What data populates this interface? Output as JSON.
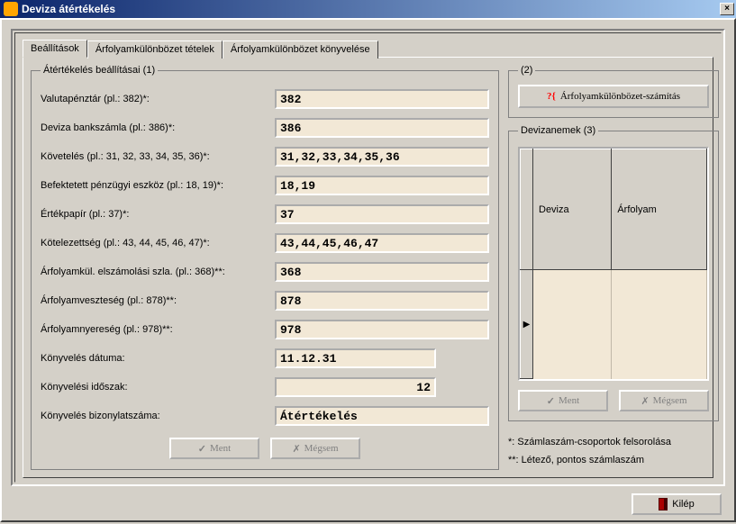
{
  "window": {
    "title": "Deviza átértékelés"
  },
  "tabs": {
    "t1": "Beállítások",
    "t2": "Árfolyamkülönbözet tételek",
    "t3": "Árfolyamkülönbözet könyvelése"
  },
  "groupbox": {
    "left": "Átértékelés beállításai (1)",
    "topright": "(2)",
    "dev": "Devizanemek (3)"
  },
  "labels": {
    "valutapenztar": "Valutapénztár (pl.: 382)*:",
    "deviza_bank": "Deviza bankszámla (pl.: 386)*:",
    "koveteles": "Követelés (pl.: 31, 32, 33, 34, 35, 36)*:",
    "befektetett": "Befektetett pénzügyi eszköz (pl.: 18, 19)*:",
    "ertekpapir": "Értékpapír (pl.: 37)*:",
    "kotelezettseg": "Kötelezettség (pl.: 43, 44, 45, 46, 47)*:",
    "arf_elszamolasi": "Árfolyamkül. elszámolási szla. (pl.: 368)**:",
    "arf_veszteseg": "Árfolyamveszteség (pl.: 878)**:",
    "arf_nyereseg": "Árfolyamnyereség (pl.: 978)**:",
    "konyv_datum": "Könyvelés dátuma:",
    "konyv_idoszak": "Könyvelési időszak:",
    "konyv_bizonylat": "Könyvelés bizonylatszáma:"
  },
  "values": {
    "valutapenztar": "382",
    "deviza_bank": "386",
    "koveteles": "31,32,33,34,35,36",
    "befektetett": "18,19",
    "ertekpapir": "37",
    "kotelezettseg": "43,44,45,46,47",
    "arf_elszamolasi": "368",
    "arf_veszteseg": "878",
    "arf_nyereseg": "978",
    "konyv_datum": "11.12.31",
    "konyv_idoszak": "12",
    "konyv_bizonylat": "Átértékelés"
  },
  "buttons": {
    "ment": "Ment",
    "megsem": "Mégsem",
    "calc": "Árfolyamkülönbözet-számítás",
    "kilep": "Kilép"
  },
  "grid": {
    "col1": "Deviza",
    "col2": "Árfolyam"
  },
  "notes": {
    "n1": "*: Számlaszám-csoportok felsorolása",
    "n2": "**: Létező, pontos számlaszám"
  }
}
